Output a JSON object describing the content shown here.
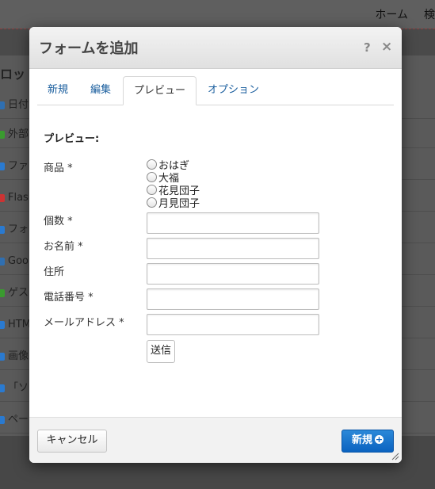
{
  "background": {
    "nav": [
      "ホーム",
      "検"
    ],
    "panel_title": "ロッ",
    "items": [
      {
        "label": "日付",
        "color": "#2f6fb1"
      },
      {
        "label": "外部",
        "color": "#3a9b2f"
      },
      {
        "label": "ファ",
        "color": "#2a7ad0"
      },
      {
        "label": "Flas",
        "color": "#c33"
      },
      {
        "label": "フォ",
        "color": "#2a7ad0"
      },
      {
        "label": "Goo",
        "color": "#2f6fb1"
      },
      {
        "label": "ゲス",
        "color": "#3a9b2f"
      },
      {
        "label": "HTM",
        "color": "#2a7ad0"
      },
      {
        "label": "画像",
        "color": "#2a7ad0"
      },
      {
        "label": "「ソ",
        "color": "#2a7ad0"
      },
      {
        "label": "ペー",
        "color": "#2a7ad0"
      }
    ]
  },
  "dialog": {
    "title": "フォームを追加",
    "help": "?",
    "close": "×",
    "tabs": [
      "新規",
      "編集",
      "プレビュー",
      "オプション"
    ],
    "active_tab": "プレビュー",
    "section_title": "プレビュー:",
    "fields": {
      "product_label": "商品 *",
      "product_options": [
        "おはぎ",
        "大福",
        "花見団子",
        "月見団子"
      ],
      "quantity_label": "個数 *",
      "name_label": "お名前 *",
      "address_label": "住所",
      "phone_label": "電話番号 *",
      "email_label": "メールアドレス *"
    },
    "submit_label": "送信",
    "cancel_label": "キャンセル",
    "new_label": "新規"
  }
}
